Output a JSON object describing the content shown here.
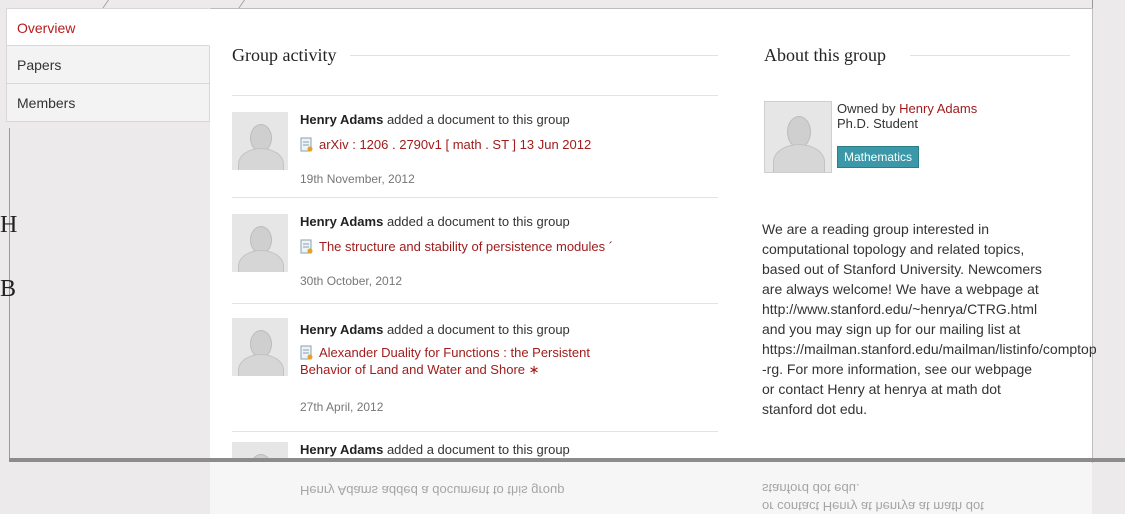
{
  "sidebar": {
    "items": [
      {
        "label": "Overview",
        "active": true
      },
      {
        "label": "Papers"
      },
      {
        "label": "Members"
      }
    ]
  },
  "background_letters": [
    "H",
    "B"
  ],
  "activity": {
    "title": "Group activity",
    "items": [
      {
        "user": "Henry Adams",
        "action": " added a document to this group",
        "document": "arXiv : 1206 . 2790v1 [ math . ST ] 13 Jun 2012",
        "date": "19th November, 2012"
      },
      {
        "user": "Henry Adams",
        "action": " added a document to this group",
        "document": "The structure and stability of persistence modules ´",
        "date": "30th October, 2012"
      },
      {
        "user": "Henry Adams",
        "action": " added a document to this group",
        "document": "Alexander Duality for Functions : the Persistent Behavior of Land and Water and Shore ∗",
        "date": "27th April, 2012"
      },
      {
        "user": "Henry Adams",
        "action": " added a document to this group"
      }
    ]
  },
  "about": {
    "title": "About this group",
    "owned_by_prefix": "Owned by ",
    "owner": "Henry Adams",
    "owner_role": "Ph.D. Student",
    "tag": "Mathematics",
    "description_lines": [
      "We are a reading group interested in",
      "computational topology and related topics,",
      "based out of Stanford University. Newcomers",
      "are always welcome! We have a webpage at",
      "http://www.stanford.edu/~henrya/CTRG.html",
      "and you may sign up for our mailing list at",
      "https://mailman.stanford.edu/mailman/listinfo/comptop",
      "-rg. For more information, see our webpage",
      "or contact Henry at henrya at math dot",
      "stanford dot edu."
    ]
  },
  "reflection": {
    "left_text": "Henry Adams added a document to this group",
    "right_line_1": "stanford dot edu.",
    "right_line_2": "or contact Henry at henrya at math dot"
  },
  "colors": {
    "accent_red": "#a11c1c",
    "tag_teal": "#3a98a8"
  }
}
